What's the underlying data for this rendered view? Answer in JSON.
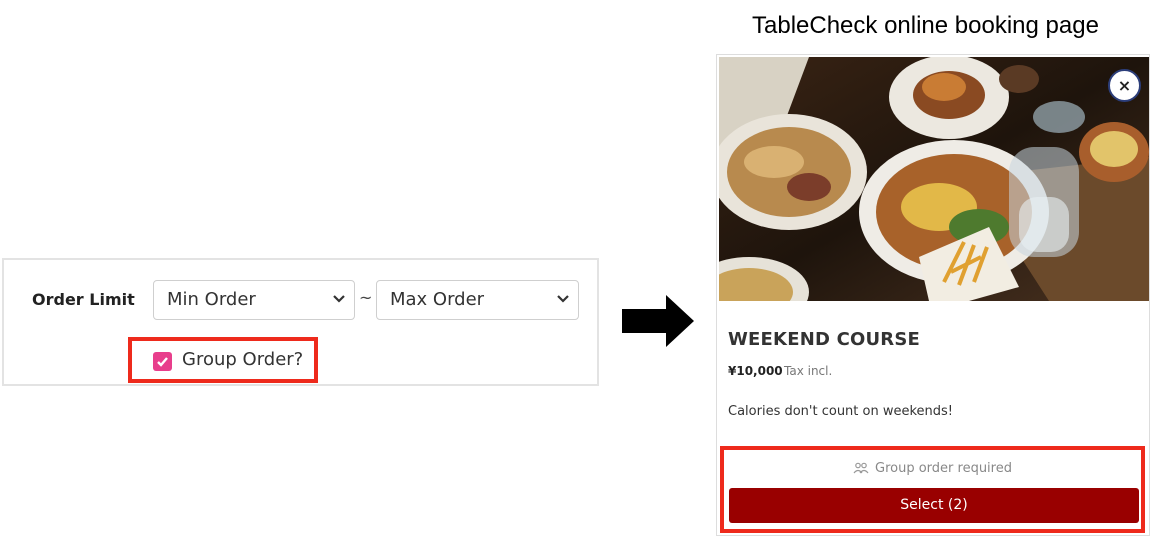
{
  "admin": {
    "order_limit_label": "Order Limit",
    "min_order": {
      "selected": "Min Order"
    },
    "separator": "~",
    "max_order": {
      "selected": "Max Order"
    },
    "group_order": {
      "label": "Group Order?",
      "checked": true
    }
  },
  "caption": "TableCheck online booking page",
  "card": {
    "close_glyph": "×",
    "course_name": "WEEKEND COURSE",
    "price": "¥10,000",
    "tax_note": "Tax incl.",
    "description": "Calories don't count on weekends!",
    "group_notice": "Group order required",
    "select_button": "Select (2)"
  },
  "colors": {
    "highlight": "#ee2a1c",
    "checkbox": "#e83e8c",
    "select_button": "#990000"
  },
  "icons": [
    "chevron-down-icon",
    "check-icon",
    "arrow-right-icon",
    "close-icon",
    "group-icon"
  ]
}
